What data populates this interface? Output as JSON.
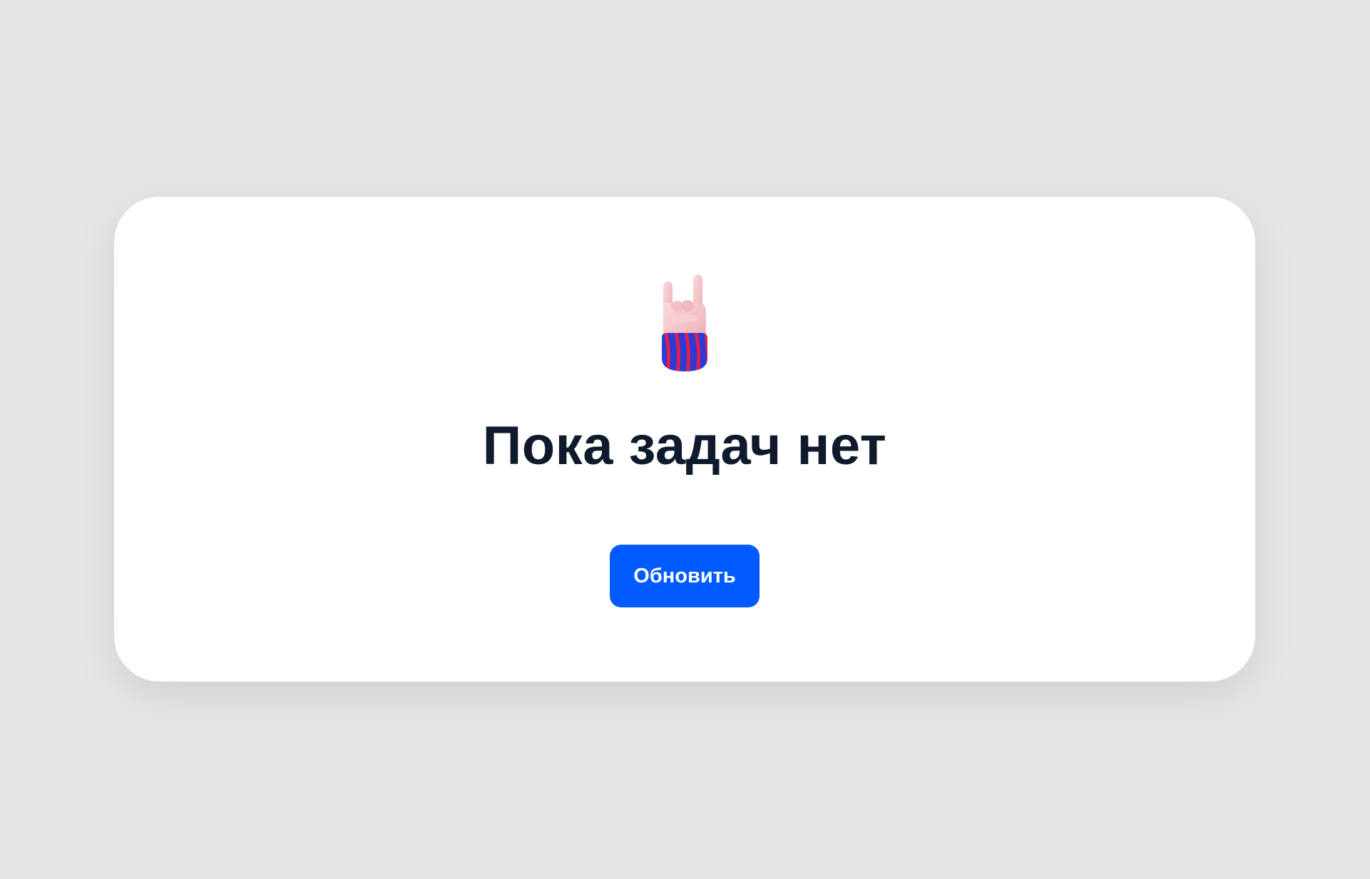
{
  "empty_state": {
    "icon": "rock-hand-icon",
    "title": "Пока задач нет",
    "refresh_label": "Обновить"
  },
  "colors": {
    "page_background": "#e6e6e6",
    "card_background": "#ffffff",
    "title_text": "#0f1b2d",
    "button_background": "#005bff",
    "button_text": "#ffffff",
    "sleeve_blue": "#2a3bd6",
    "sleeve_red": "#e01f4f",
    "skin": "#f6c9cd"
  }
}
